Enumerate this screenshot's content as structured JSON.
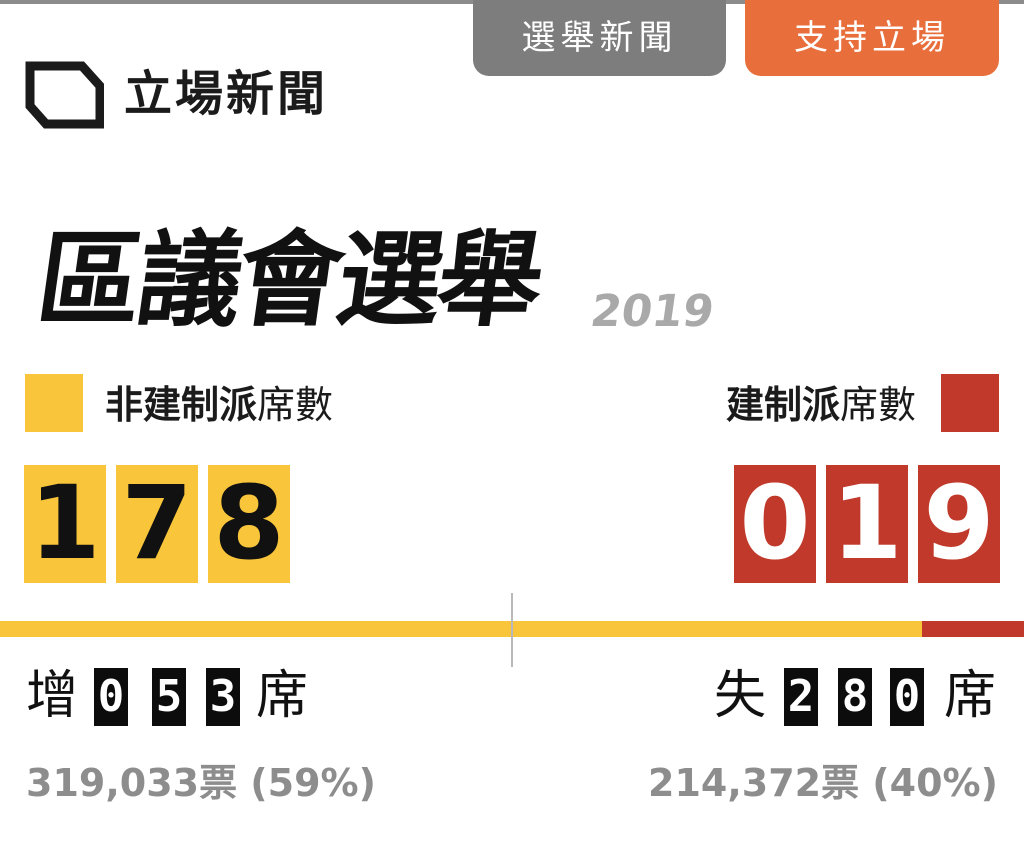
{
  "tabs": {
    "election_news": "選舉新聞",
    "support": "支持立場"
  },
  "brand": {
    "name": "立場新聞",
    "logo_icon": "hexagon-outline-logo"
  },
  "headline": {
    "title": "區議會選舉",
    "year": "2019"
  },
  "colors": {
    "pro_democracy": "#f8c53b",
    "pro_establishment": "#c0392b",
    "support_tab": "#e86f3c",
    "news_tab": "#7d7d7d"
  },
  "left": {
    "label_bold": "非建制派",
    "label_rest": "席數",
    "digits": [
      "1",
      "7",
      "8"
    ],
    "change_word": "增",
    "change_digits": [
      "0",
      "5",
      "3"
    ],
    "change_unit": "席",
    "votes": "319,033票 (59%)"
  },
  "right": {
    "label_bold": "建制派",
    "label_rest": "席數",
    "digits": [
      "0",
      "1",
      "9"
    ],
    "change_word": "失",
    "change_digits": [
      "2",
      "8",
      "0"
    ],
    "change_unit": "席",
    "votes": "214,372票 (40%)"
  },
  "seat_bar": {
    "pro_democracy_share": 0.9
  }
}
